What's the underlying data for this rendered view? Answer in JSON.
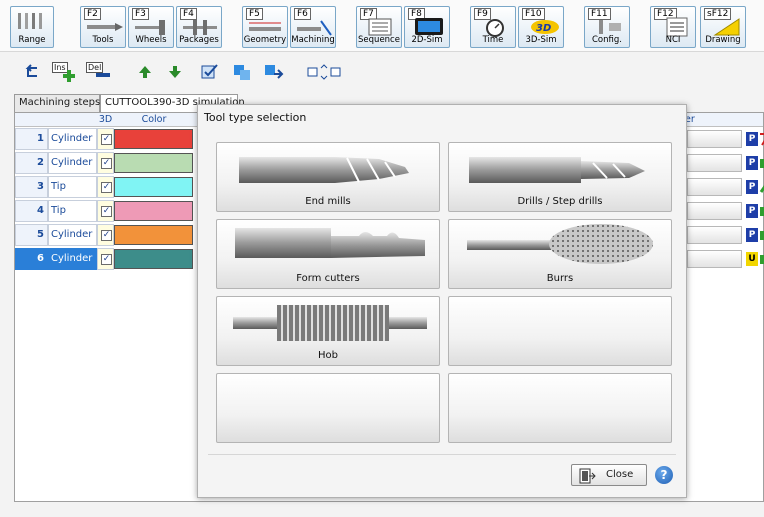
{
  "toolbar": {
    "buttons": [
      {
        "key": "",
        "label": "Range"
      },
      {
        "key": "F2",
        "label": "Tools"
      },
      {
        "key": "F3",
        "label": "Wheels"
      },
      {
        "key": "F4",
        "label": "Packages"
      },
      {
        "key": "F5",
        "label": "Geometry"
      },
      {
        "key": "F6",
        "label": "Machining"
      },
      {
        "key": "F7",
        "label": "Sequence"
      },
      {
        "key": "F8",
        "label": "2D-Sim"
      },
      {
        "key": "F9",
        "label": "Time"
      },
      {
        "key": "F10",
        "label": "3D-Sim"
      },
      {
        "key": "F11",
        "label": "Config."
      },
      {
        "key": "F12",
        "label": "NCI"
      },
      {
        "key": "sF12",
        "label": "Drawing"
      }
    ]
  },
  "toolbar2": {
    "ins_label": "Ins",
    "del_label": "Del"
  },
  "tabs": [
    {
      "label": "Machining steps"
    },
    {
      "label": "CUTTOOL390-3D simulation"
    }
  ],
  "grid": {
    "headers": {
      "col3d": "3D",
      "color": "Color",
      "other": "ner"
    },
    "rows": [
      {
        "num": "1",
        "type": "Cylinder",
        "checked": "✓",
        "color": "#e8413a",
        "icon": "P"
      },
      {
        "num": "2",
        "type": "Cylinder",
        "checked": "✓",
        "color": "#b9dcb2",
        "icon": "P"
      },
      {
        "num": "3",
        "type": "Tip",
        "checked": "✓",
        "color": "#80f4f4",
        "icon": "P"
      },
      {
        "num": "4",
        "type": "Tip",
        "checked": "✓",
        "color": "#ee9ab6",
        "icon": "P"
      },
      {
        "num": "5",
        "type": "Cylinder",
        "checked": "✓",
        "color": "#f2923a",
        "icon": "P"
      },
      {
        "num": "6",
        "type": "Cylinder",
        "checked": "✓",
        "color": "#3d8d8a",
        "icon": "U"
      }
    ]
  },
  "modal": {
    "title": "Tool type selection",
    "tiles": [
      {
        "label": "End mills"
      },
      {
        "label": "Drills / Step drills"
      },
      {
        "label": "Form cutters"
      },
      {
        "label": "Burrs"
      },
      {
        "label": "Hob"
      },
      {
        "label": ""
      },
      {
        "label": ""
      },
      {
        "label": ""
      }
    ],
    "close_label": "Close",
    "help_label": "?"
  }
}
